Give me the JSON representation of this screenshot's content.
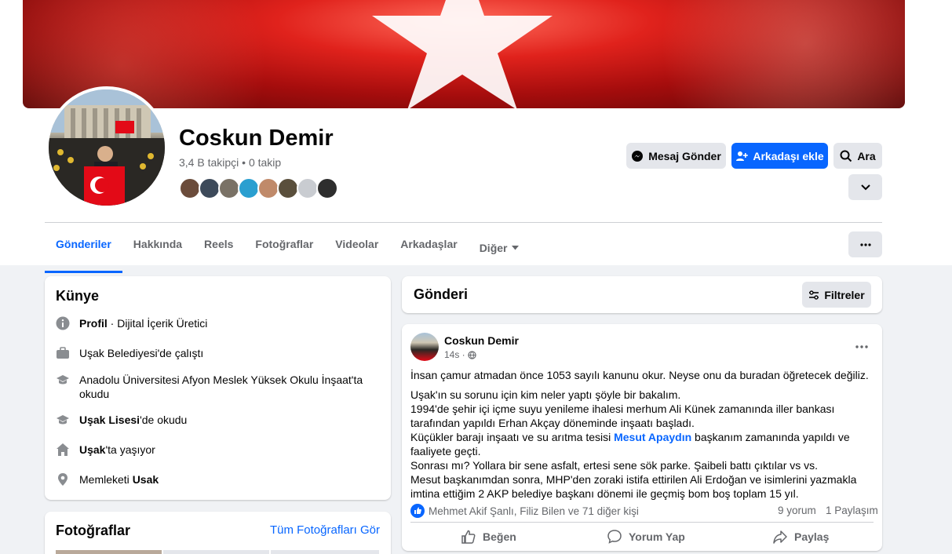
{
  "profile": {
    "name": "Coskun Demir",
    "followers": "3,4 B takipçi • 0 takip"
  },
  "actions": {
    "message": "Mesaj Gönder",
    "add_friend": "Arkadaşı ekle",
    "search": "Ara"
  },
  "tabs": [
    {
      "label": "Gönderiler",
      "active": true
    },
    {
      "label": "Hakkında"
    },
    {
      "label": "Reels"
    },
    {
      "label": "Fotoğraflar"
    },
    {
      "label": "Videolar"
    },
    {
      "label": "Arkadaşlar"
    },
    {
      "label": "Diğer"
    }
  ],
  "intro": {
    "title": "Künye",
    "items": [
      {
        "icon": "info-icon",
        "bold": "Profil",
        "text": " · Dijital İçerik Üretici"
      },
      {
        "icon": "briefcase-icon",
        "text": "Uşak Belediyesi'de çalıştı"
      },
      {
        "icon": "graduation-cap-icon",
        "text": "Anadolu Üniversitesi Afyon Meslek Yüksek Okulu İnşaat'ta okudu"
      },
      {
        "icon": "graduation-cap-icon",
        "bold": "Uşak Lisesi",
        "text": "'de okudu"
      },
      {
        "icon": "home-icon",
        "bold": "Uşak",
        "text": "'ta yaşıyor"
      },
      {
        "icon": "location-pin-icon",
        "text": "Memleketi ",
        "bold2": "Usak"
      }
    ]
  },
  "photos": {
    "title": "Fotoğraflar",
    "see_all": "Tüm Fotoğrafları Gör"
  },
  "posts_header": {
    "title": "Gönderi",
    "filters": "Filtreler"
  },
  "post": {
    "author": "Coskun Demir",
    "time": "14s ·",
    "line1": "İnsan çamur atmadan önce 1053 sayılı kanunu okur.  Neyse onu da buradan öğretecek değiliz.",
    "p2_1": "Uşak'ın su sorunu için kim neler yaptı şöyle bir bakalım.",
    "p2_2": "1994'de şehir içi içme suyu yenileme ihalesi merhum Ali Künek zamanında iller bankası tarafından yapıldı Erhan Akçay döneminde inşaatı başladı.",
    "p2_3a": "Küçükler barajı inşaatı ve su arıtma tesisi ",
    "p2_3link": "Mesut Apaydın",
    "p2_3b": "  başkanım zamanında yapıldı ve faaliyete geçti.",
    "p2_4": "Sonrası mı? Yollara bir sene asfalt, ertesi sene sök parke. Şaibeli battı çıktılar vs vs.",
    "p2_5": "Mesut başkanımdan sonra, MHP'den zoraki istifa ettirilen Ali Erdoğan ve isimlerini yazmakla imtina ettiğim 2 AKP belediye başkanı dönemi ile geçmiş bom boş toplam 15 yıl.",
    "reactions": "Mehmet Akif Şanlı, Filiz Bilen ve 71 diğer kişi",
    "comments": "9 yorum",
    "shares": "1 Paylaşım",
    "like": "Beğen",
    "comment": "Yorum Yap",
    "share": "Paylaş"
  },
  "colors": {
    "accent": "#0866ff",
    "background": "#f0f2f5",
    "secondary_text": "#65676b"
  }
}
